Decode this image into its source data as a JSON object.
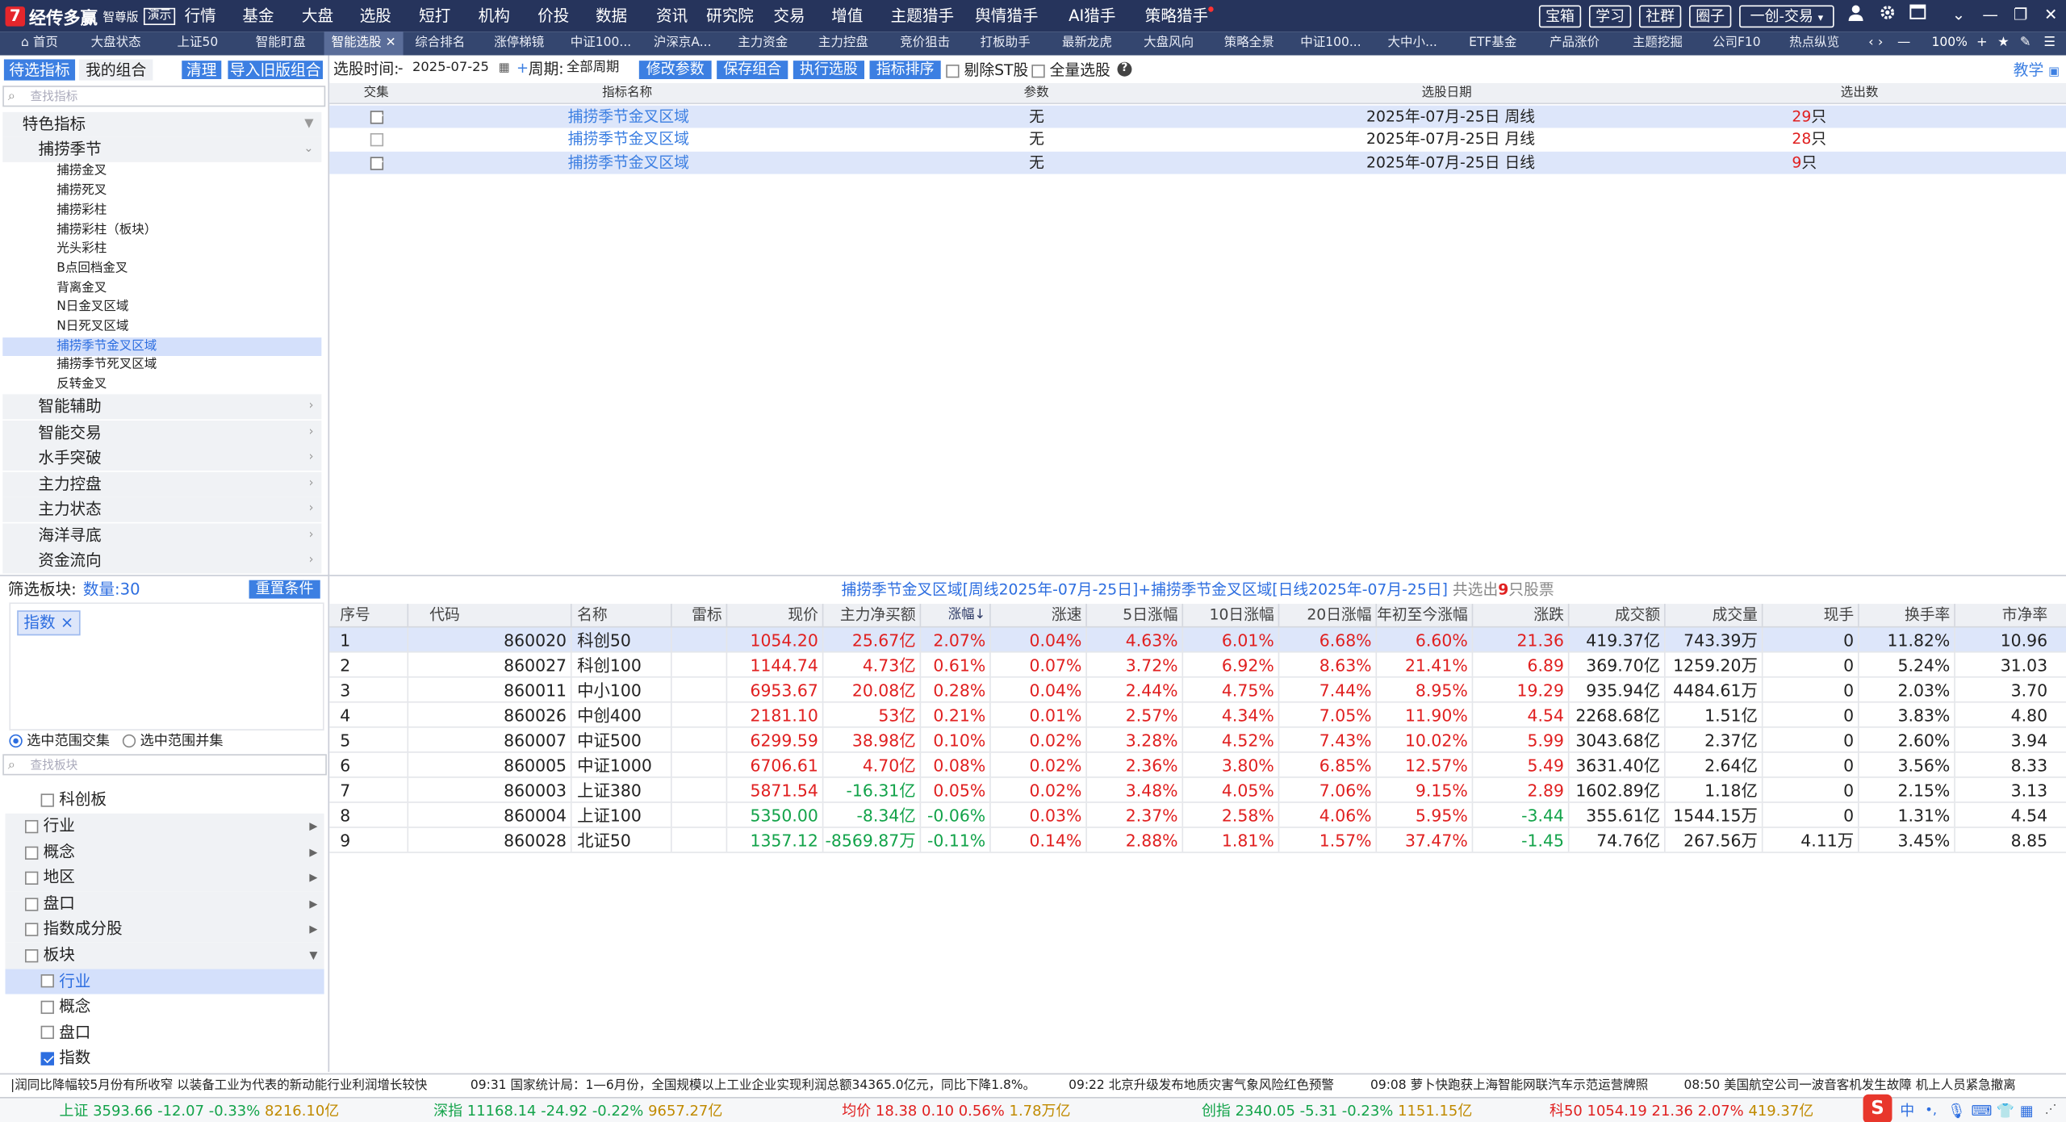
{
  "app": {
    "brand": "经传多赢",
    "edition": "智尊版",
    "demo": "演示"
  },
  "menu": [
    "行情",
    "基金",
    "大盘",
    "选股",
    "短打",
    "机构",
    "价投",
    "数据",
    "资讯",
    "研究院",
    "交易",
    "增值",
    "主题猎手",
    "舆情猎手",
    "AI猎手",
    "策略猎手"
  ],
  "top_buttons": [
    "宝箱",
    "学习",
    "社群",
    "圈子",
    "一创-交易"
  ],
  "tabs": [
    "首页",
    "大盘状态",
    "上证50",
    "智能盯盘",
    "智能选股",
    "综合排名",
    "涨停梯镜",
    "中证100...",
    "沪深京A...",
    "主力资金",
    "主力控盘",
    "竞价狙击",
    "打板助手",
    "最新龙虎",
    "大盘风向",
    "策略全景",
    "中证100...",
    "大中小...",
    "ETF基金",
    "产品涨价",
    "主题挖掘",
    "公司F10",
    "热点纵览"
  ],
  "zoom": "100%",
  "left": {
    "tab_active": "待选指标",
    "tab_other": "我的组合",
    "btn_clear": "清理",
    "btn_import": "导入旧版组合",
    "search_placeholder": "查找指标",
    "category": "特色指标",
    "subcategory": "捕捞季节",
    "leaves": [
      "捕捞金叉",
      "捕捞死叉",
      "捕捞彩柱",
      "捕捞彩柱（板块）",
      "光头彩柱",
      "B点回档金叉",
      "背离金叉",
      "N日金叉区域",
      "N日死叉区域",
      "捕捞季节金叉区域",
      "捕捞季节死叉区域",
      "反转金叉"
    ],
    "selected_leaf": "捕捞季节金叉区域",
    "groups": [
      "智能辅助",
      "智能交易",
      "水手突破",
      "主力控盘",
      "主力状态",
      "海洋寻底",
      "资金流向"
    ]
  },
  "filter": {
    "label": "筛选板块:",
    "count": "数量:30",
    "reset": "重置条件",
    "tag": "指数",
    "tag_close": "×",
    "radio_1": "选中范围交集",
    "radio_2": "选中范围并集",
    "search_placeholder": "查找板块",
    "partial": "科创板",
    "items": [
      {
        "label": "行业",
        "checked": false,
        "style": "gray",
        "arrow": "▶"
      },
      {
        "label": "概念",
        "checked": false,
        "style": "gray",
        "arrow": "▶"
      },
      {
        "label": "地区",
        "checked": false,
        "style": "gray",
        "arrow": "▶"
      },
      {
        "label": "盘口",
        "checked": false,
        "style": "gray",
        "arrow": "▶"
      },
      {
        "label": "指数成分股",
        "checked": false,
        "style": "gray",
        "arrow": "▶"
      },
      {
        "label": "板块",
        "checked": false,
        "style": "gray",
        "arrow": "▼"
      }
    ],
    "sub_items": [
      {
        "label": "行业",
        "checked": false,
        "selected": true
      },
      {
        "label": "概念",
        "checked": false,
        "selected": false
      },
      {
        "label": "盘口",
        "checked": false,
        "selected": false
      },
      {
        "label": "指数",
        "checked": true,
        "selected": false
      }
    ]
  },
  "toolbar": {
    "time_label": "选股时间:",
    "date_dash": "-",
    "date": "2025-07-25",
    "plus": "+",
    "period_label": "周期:",
    "period": "全部周期",
    "btn_modify": "修改参数",
    "btn_save": "保存组合",
    "btn_run": "执行选股",
    "btn_sort": "指标排序",
    "st_label": "剔除ST股",
    "all_label": "全量选股",
    "help": "?",
    "teach": "教学"
  },
  "indicator_table": {
    "headers": [
      "交集",
      "指标名称",
      "参数",
      "选股日期",
      "选出数"
    ],
    "rows": [
      {
        "checked": true,
        "name": "捕捞季节金叉区域",
        "param": "无",
        "date": "2025年-07月-25日 周线",
        "count": "29",
        "unit": "只"
      },
      {
        "checked": false,
        "name": "捕捞季节金叉区域",
        "param": "无",
        "date": "2025年-07月-25日 月线",
        "count": "28",
        "unit": "只"
      },
      {
        "checked": true,
        "name": "捕捞季节金叉区域",
        "param": "无",
        "date": "2025年-07月-25日 日线",
        "count": "9",
        "unit": "只"
      }
    ]
  },
  "result": {
    "title": "捕捞季节金叉区域[周线2025年-07月-25日]+捕捞季节金叉区域[日线2025年-07月-25日]",
    "pre": "共选出",
    "count": "9",
    "post": "只股票",
    "headers": [
      "序号",
      "代码",
      "名称",
      "雷标",
      "现价",
      "主力净买额",
      "涨幅↓",
      "涨速",
      "5日涨幅",
      "10日涨幅",
      "20日涨幅",
      "年初至今涨幅",
      "涨跌",
      "成交额",
      "成交量",
      "现手",
      "换手率",
      "市净率"
    ],
    "rows": [
      [
        "1",
        "860020",
        "科创50",
        "",
        "1054.20",
        "25.67亿",
        "2.07%",
        "0.04%",
        "4.63%",
        "6.01%",
        "6.68%",
        "6.60%",
        "21.36",
        "419.37亿",
        "743.39万",
        "0",
        "11.82%",
        "10.96"
      ],
      [
        "2",
        "860027",
        "科创100",
        "",
        "1144.74",
        "4.73亿",
        "0.61%",
        "0.07%",
        "3.72%",
        "6.92%",
        "8.63%",
        "21.41%",
        "6.89",
        "369.70亿",
        "1259.20万",
        "0",
        "5.24%",
        "31.03"
      ],
      [
        "3",
        "860011",
        "中小100",
        "",
        "6953.67",
        "20.08亿",
        "0.28%",
        "0.04%",
        "2.44%",
        "4.75%",
        "7.44%",
        "8.95%",
        "19.29",
        "935.94亿",
        "4484.61万",
        "0",
        "2.03%",
        "3.70"
      ],
      [
        "4",
        "860026",
        "中创400",
        "",
        "2181.10",
        "53亿",
        "0.21%",
        "0.01%",
        "2.57%",
        "4.34%",
        "7.05%",
        "11.90%",
        "4.54",
        "2268.68亿",
        "1.51亿",
        "0",
        "3.83%",
        "4.80"
      ],
      [
        "5",
        "860007",
        "中证500",
        "",
        "6299.59",
        "38.98亿",
        "0.10%",
        "0.02%",
        "3.28%",
        "4.52%",
        "7.43%",
        "10.02%",
        "5.99",
        "3043.68亿",
        "2.37亿",
        "0",
        "2.60%",
        "3.94"
      ],
      [
        "6",
        "860005",
        "中证1000",
        "",
        "6706.61",
        "4.70亿",
        "0.08%",
        "0.02%",
        "2.36%",
        "3.80%",
        "6.85%",
        "12.57%",
        "5.49",
        "3631.40亿",
        "2.64亿",
        "0",
        "3.56%",
        "8.33"
      ],
      [
        "7",
        "860003",
        "上证380",
        "",
        "5871.54",
        "-16.31亿",
        "0.05%",
        "0.02%",
        "3.48%",
        "4.05%",
        "7.06%",
        "9.15%",
        "2.89",
        "1602.89亿",
        "1.18亿",
        "0",
        "2.15%",
        "3.13"
      ],
      [
        "8",
        "860004",
        "上证100",
        "",
        "5350.00",
        "-8.34亿",
        "-0.06%",
        "0.03%",
        "2.37%",
        "2.58%",
        "4.06%",
        "5.95%",
        "-3.44",
        "355.61亿",
        "1544.15万",
        "0",
        "1.31%",
        "4.54"
      ],
      [
        "9",
        "860028",
        "北证50",
        "",
        "1357.12",
        "-8569.87万",
        "-0.11%",
        "0.14%",
        "2.88%",
        "1.81%",
        "1.57%",
        "37.47%",
        "-1.45",
        "74.76亿",
        "267.56万",
        "4.11万",
        "3.45%",
        "8.85"
      ]
    ]
  },
  "news": [
    "|润同比降幅较5月份有所收窄 以装备工业为代表的新动能行业利润增长较快",
    "09:31 国家统计局：1—6月份，全国规模以上工业企业实现利润总额34365.0亿元，同比下降1.8%。",
    "09:22 北京升级发布地质灾害气象风险红色预警",
    "09:08 萝卜快跑获上海智能网联汽车示范运营牌照",
    "08:50 美国航空公司一波音客机发生故障 机上人员紧急撤离"
  ],
  "status": [
    {
      "name": "上证",
      "price": "3593.66",
      "change": "-12.07",
      "pct": "-0.33%",
      "amount": "8216.10亿"
    },
    {
      "name": "深指",
      "price": "11168.14",
      "change": "-24.92",
      "pct": "-0.22%",
      "amount": "9657.27亿"
    },
    {
      "name": "均价",
      "price": "18.38",
      "change": "0.10",
      "pct": "0.56%",
      "amount": "1.78万亿"
    },
    {
      "name": "创指",
      "price": "2340.05",
      "change": "-5.31",
      "pct": "-0.23%",
      "amount": "1151.15亿"
    },
    {
      "name": "科50",
      "price": "1054.19",
      "change": "21.36",
      "pct": "2.07%",
      "amount": "419.37亿"
    }
  ],
  "tray": [
    "中",
    "•,",
    "mic",
    "kbd",
    "shirt",
    "grid"
  ],
  "colors": {
    "up": "#e02020",
    "down": "#13a34a",
    "accent": "#3c7fe2",
    "topbar": "#26345c",
    "tabbar": "#34466f",
    "selected": "#dde6fa"
  }
}
